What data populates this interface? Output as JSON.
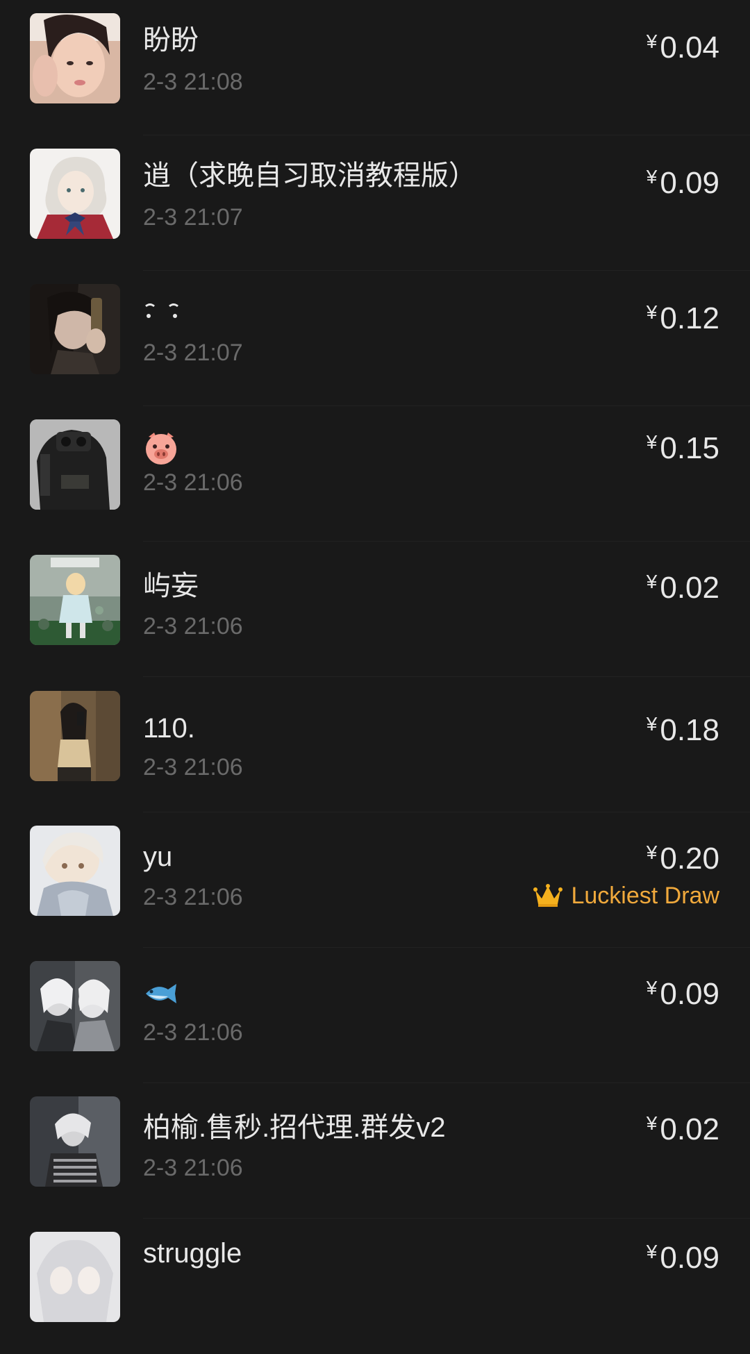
{
  "currency_symbol": "¥",
  "lucky_label": "Luckiest Draw",
  "lucky_color": "#f0a93c",
  "records": [
    {
      "name": "盼盼",
      "time": "2-3 21:08",
      "amount": "0.04"
    },
    {
      "name": "逍（求晚自习取消教程版）",
      "time": "2-3 21:07",
      "amount": "0.09"
    },
    {
      "name": "",
      "name_icon": "dots-emoticon-icon",
      "time": "2-3 21:07",
      "amount": "0.12"
    },
    {
      "name": "",
      "name_icon": "pig-face-icon",
      "time": "2-3 21:06",
      "amount": "0.15"
    },
    {
      "name": "屿妄",
      "time": "2-3 21:06",
      "amount": "0.02"
    },
    {
      "name": "110.",
      "time": "2-3 21:06",
      "amount": "0.18"
    },
    {
      "name": "yu",
      "time": "2-3 21:06",
      "amount": "0.20",
      "lucky": true
    },
    {
      "name": "",
      "name_icon": "fish-icon",
      "time": "2-3 21:06",
      "amount": "0.09"
    },
    {
      "name": "柏榆.售秒.招代理.群发v2",
      "time": "2-3 21:06",
      "amount": "0.02"
    },
    {
      "name": "struggle",
      "time": "",
      "amount": "0.09"
    }
  ]
}
